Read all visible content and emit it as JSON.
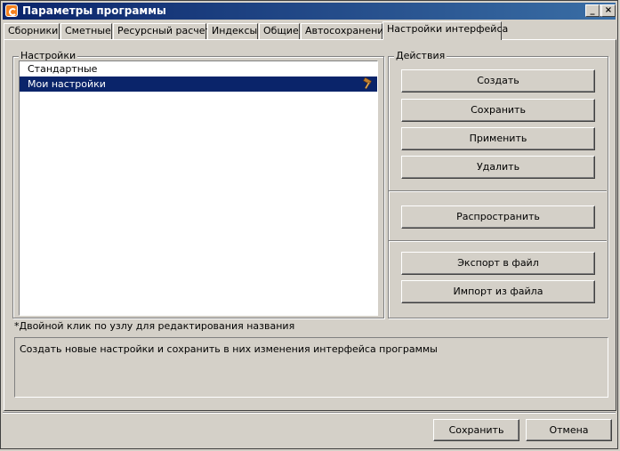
{
  "window": {
    "title": "Параметры программы",
    "controls": {
      "minimize": "_",
      "maximize": "□",
      "close": "×"
    }
  },
  "tabs": [
    {
      "label": "Сборники"
    },
    {
      "label": "Сметные"
    },
    {
      "label": "Ресурсный расчет"
    },
    {
      "label": "Индексы"
    },
    {
      "label": "Общие"
    },
    {
      "label": "Автосохранение"
    },
    {
      "label": "Настройки интерфейса",
      "active": true
    }
  ],
  "settings_group": {
    "legend": "Настройки",
    "items": [
      {
        "label": "Стандартные",
        "selected": false
      },
      {
        "label": "Мои настройки",
        "selected": true,
        "icon": "hammer-icon"
      }
    ]
  },
  "actions_group": {
    "legend": "Действия",
    "create": "Создать",
    "save": "Сохранить",
    "apply": "Применить",
    "delete": "Удалить",
    "distribute": "Распространить",
    "export": "Экспорт в файл",
    "import": "Импорт из файла"
  },
  "hint": "*Двойной клик по узлу для редактирования названия",
  "description": "Создать новые настройки и сохранить в них изменения интерфейса программы",
  "footer": {
    "save": "Сохранить",
    "cancel": "Отмена"
  },
  "colors": {
    "titlebar_start": "#0a246a",
    "titlebar_end": "#3a6ea5",
    "selection": "#0a246a",
    "face": "#d4d0c8",
    "app_icon": "#f58220"
  }
}
